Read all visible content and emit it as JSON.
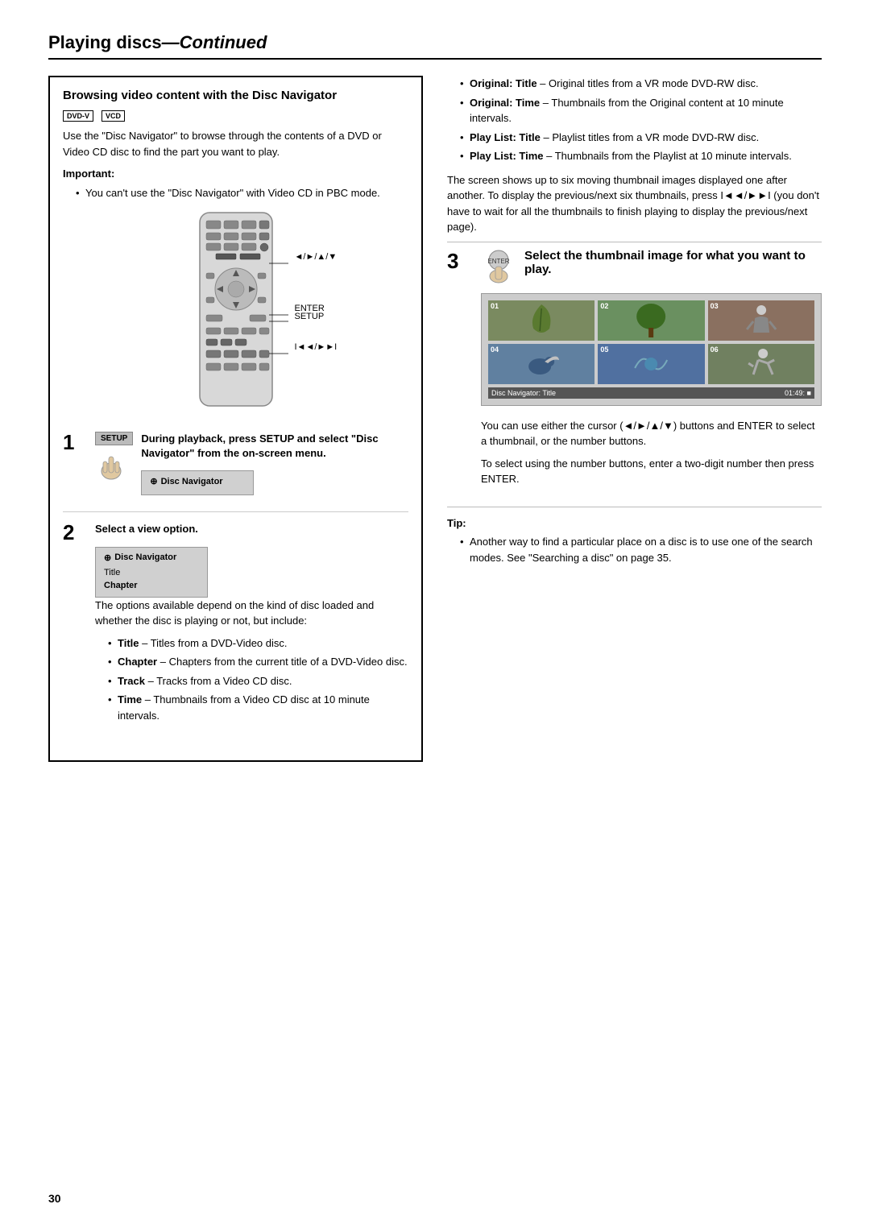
{
  "page": {
    "title": "Playing discs",
    "title_continued": "—Continued",
    "page_number": "30"
  },
  "section": {
    "heading": "Browsing video content with the Disc Navigator",
    "disc_icons": [
      "DVD-V",
      "VCD"
    ],
    "intro_text": "Use the \"Disc Navigator\" to browse through the contents of a DVD or Video CD disc to find the part you want to play.",
    "important_label": "Important:",
    "important_bullet": "You can't use the \"Disc Navigator\" with Video CD in PBC mode.",
    "remote_labels": {
      "arrows": "◄/►/▲/▼",
      "enter": "ENTER",
      "setup": "SETUP",
      "skip": "I◄◄/►►I"
    }
  },
  "steps": [
    {
      "number": "1",
      "title": "During playback, press SETUP and select \"Disc Navigator\" from the on-screen menu.",
      "menu_label": "Disc Navigator",
      "setup_label": "SETUP"
    },
    {
      "number": "2",
      "title": "Select a view option.",
      "menu_header": "Disc Navigator",
      "menu_items": [
        "Title",
        "Chapter"
      ],
      "description": "The options available depend on the kind of disc loaded and whether the disc is playing or not, but include:",
      "bullets": [
        {
          "term": "Title",
          "text": "– Titles from a DVD-Video disc."
        },
        {
          "term": "Chapter",
          "text": "– Chapters from the current title of a DVD-Video disc."
        },
        {
          "term": "Track",
          "text": "– Tracks from a Video CD disc."
        },
        {
          "term": "Time",
          "text": "– Thumbnails from a Video CD disc at 10 minute intervals."
        }
      ]
    }
  ],
  "right_col": {
    "bullets": [
      {
        "term": "Original: Title",
        "text": "– Original titles from a VR mode DVD-RW disc."
      },
      {
        "term": "Original: Time",
        "text": "– Thumbnails from the Original content at 10 minute intervals."
      },
      {
        "term": "Play List: Title",
        "text": "– Playlist titles from a VR mode DVD-RW disc."
      },
      {
        "term": "Play List: Time",
        "text": "– Thumbnails from the Playlist at 10 minute intervals."
      }
    ],
    "thumbnail_desc": "The screen shows up to six moving thumbnail images displayed one after another. To display the previous/next six thumbnails, press I◄◄/►►I (you don't have to wait for all the thumbnails to finish playing to display the previous/next page).",
    "step3": {
      "number": "3",
      "title": "Select the thumbnail image for what you want to play.",
      "disc_nav_label": "Disc Navigator: Title",
      "disc_nav_time": "01:49: ■",
      "thumb_numbers": [
        "01",
        "02",
        "03",
        "04",
        "05",
        "06"
      ]
    },
    "step3_desc1": "You can use either the cursor (◄/►/▲/▼) buttons and ENTER to select a thumbnail, or the number buttons.",
    "step3_desc2": "To select using the number buttons, enter a two-digit number then press ENTER.",
    "tip_label": "Tip:",
    "tip_text": "Another way to find a particular place on a disc is to use one of the search modes. See \"Searching a disc\" on page 35."
  }
}
